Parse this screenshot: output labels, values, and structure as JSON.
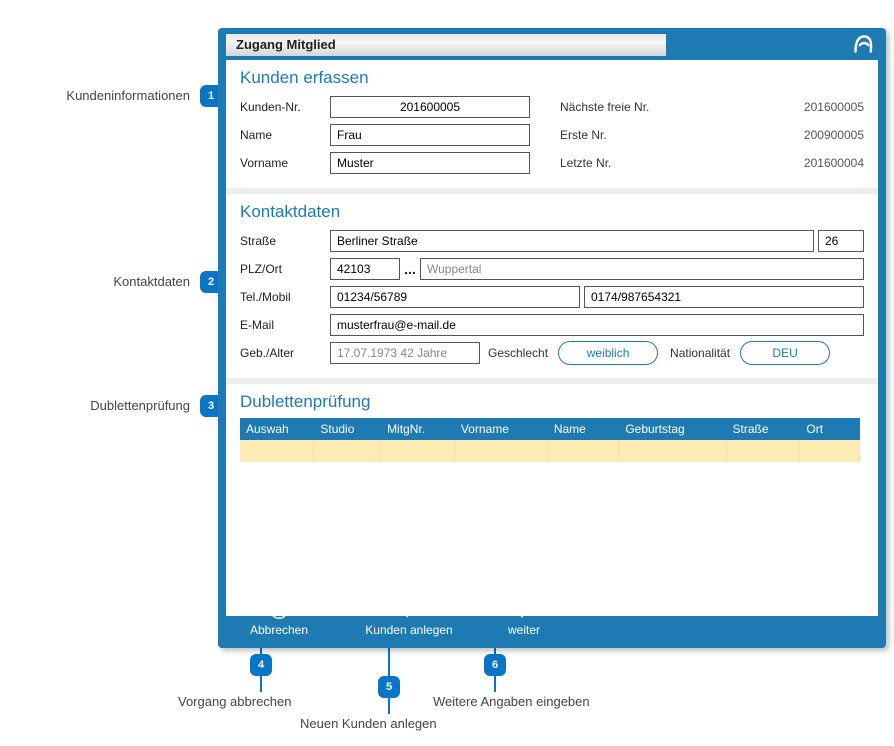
{
  "window_title": "Zugang Mitglied",
  "sections": {
    "kunden": {
      "title": "Kunden erfassen",
      "fields": {
        "kundennr_label": "Kunden-Nr.",
        "kundennr_value": "201600005",
        "name_label": "Name",
        "name_value": "Frau",
        "vorname_label": "Vorname",
        "vorname_value": "Muster"
      },
      "stats": {
        "next_label": "Nächste freie Nr.",
        "next_value": "201600005",
        "first_label": "Erste Nr.",
        "first_value": "200900005",
        "last_label": "Letzte Nr.",
        "last_value": "201600004"
      }
    },
    "kontakt": {
      "title": "Kontaktdaten",
      "strasse_label": "Straße",
      "strasse_value": "Berliner Straße",
      "hausnr_value": "26",
      "plz_label": "PLZ/Ort",
      "plz_value": "42103",
      "ort_value": "Wuppertal",
      "tel_label": "Tel./Mobil",
      "tel_value": "01234/56789",
      "mobil_value": "0174/987654321",
      "email_label": "E-Mail",
      "email_value": "musterfrau@e-mail.de",
      "geb_label": "Geb./Alter",
      "geb_value": "17.07.1973 42 Jahre",
      "geschlecht_label": "Geschlecht",
      "geschlecht_value": "weiblich",
      "nationalitaet_label": "Nationalität",
      "nationalitaet_value": "DEU"
    },
    "dubletten": {
      "title": "Dublettenprüfung",
      "headers": [
        "Auswah",
        "Studio",
        "MitgNr.",
        "Vorname",
        "Name",
        "Geburtstag",
        "Straße",
        "Ort"
      ]
    }
  },
  "footer": {
    "abbrechen": "Abbrechen",
    "kunden_anlegen": "Kunden anlegen",
    "weiter": "weiter"
  },
  "annotations": {
    "c1": "Kundeninformationen",
    "c2": "Kontaktdaten",
    "c3": "Dublettenprüfung",
    "c4": "Vorgang abbrechen",
    "c5": "Neuen Kunden anlegen",
    "c6": "Weitere Angaben eingeben"
  }
}
